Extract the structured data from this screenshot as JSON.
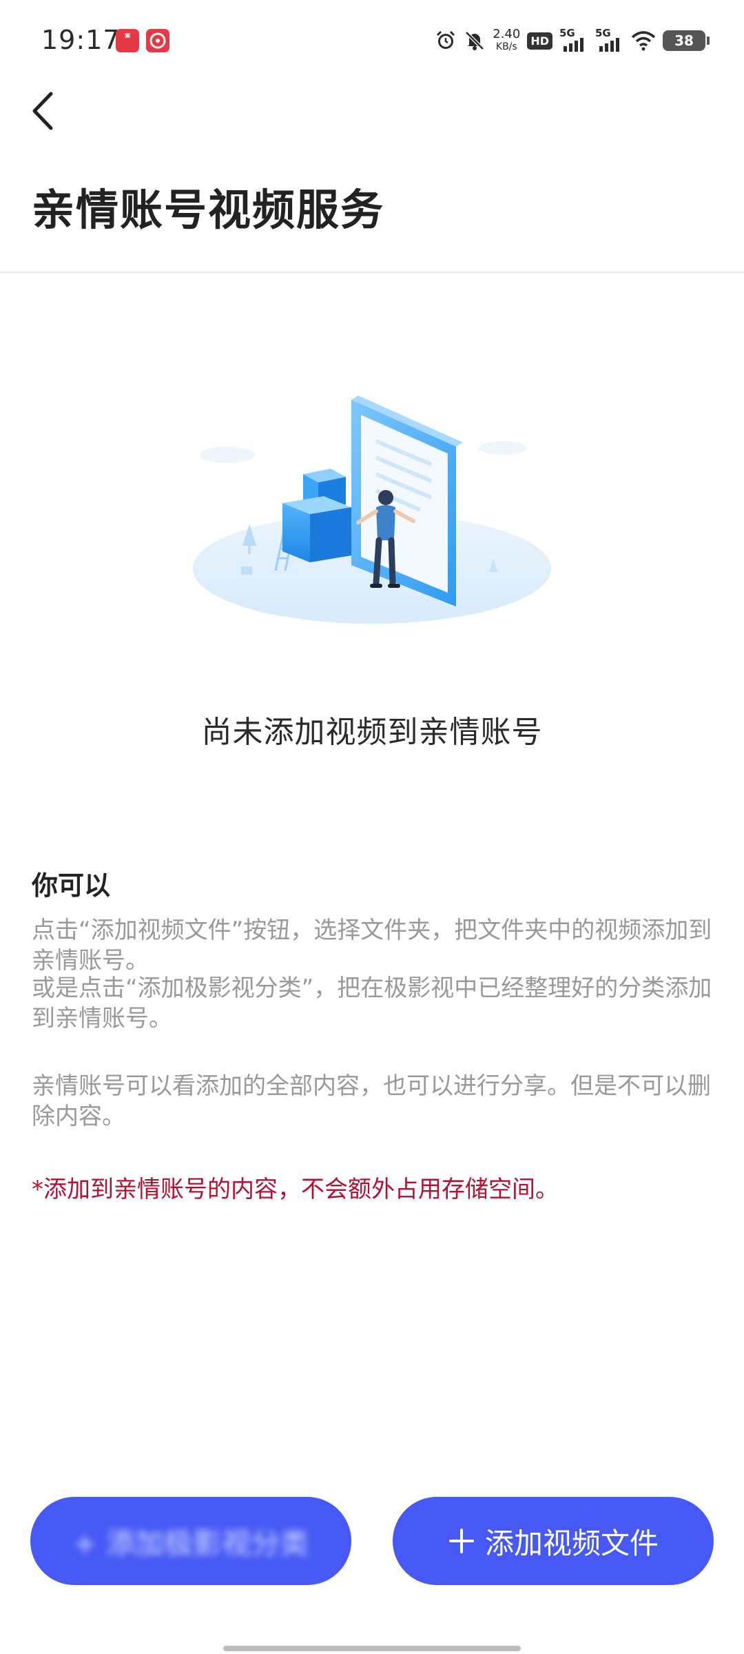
{
  "status_bar": {
    "time": "19:17",
    "net_speed_value": "2.40",
    "net_speed_unit": "KB/s",
    "hd_label": "HD",
    "signal1_label": "5G",
    "signal2_label": "5G",
    "battery_level": "38",
    "app_icon_1": "app-notification-icon",
    "app_icon_2": "netease-music-icon"
  },
  "header": {
    "back_icon": "chevron-left-icon",
    "title": "亲情账号视频服务"
  },
  "empty_state": {
    "illustration": "empty-folder-illustration",
    "title": "尚未添加视频到亲情账号"
  },
  "info": {
    "heading": "你可以",
    "paragraph1": "点击“添加视频文件”按钮，选择文件夹，把文件夹中的视频添加到亲情账号。",
    "paragraph2": "或是点击“添加极影视分类”，把在极影视中已经整理好的分类添加到亲情账号。",
    "paragraph3": "亲情账号可以看添加的全部内容，也可以进行分享。但是不可以删除内容。",
    "notice": "*添加到亲情账号的内容，不会额外占用存储空间。"
  },
  "buttons": {
    "left_label": "+ 添加极影视分类",
    "right_label": "添加视频文件",
    "accent_color": "#4659f5"
  },
  "colors": {
    "notice": "#b3112f",
    "muted_text": "#999999"
  }
}
